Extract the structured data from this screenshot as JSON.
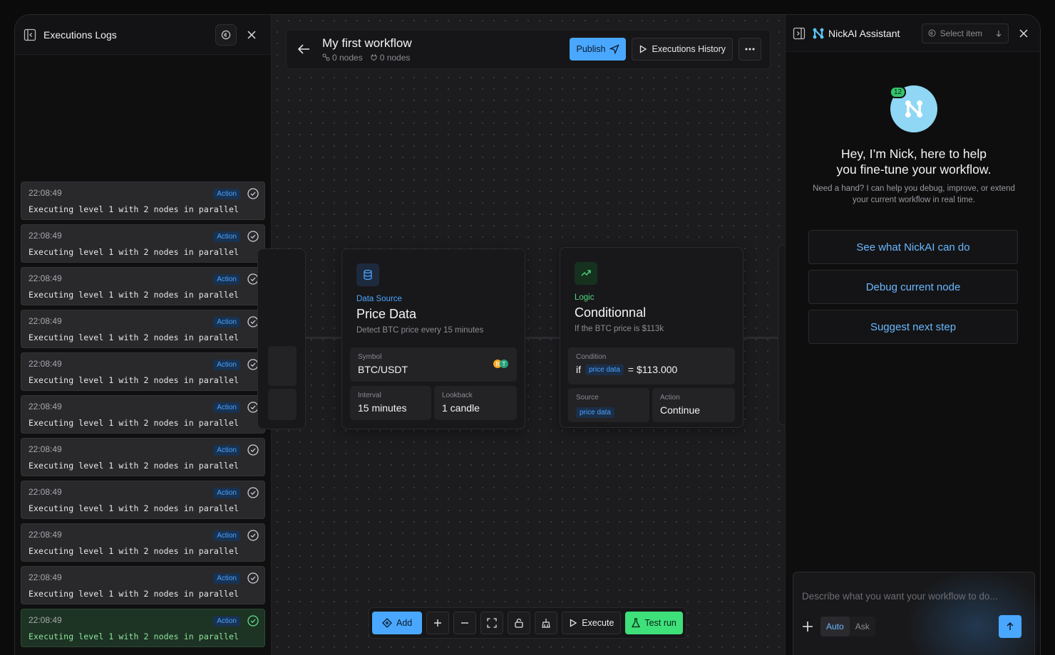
{
  "logs": {
    "title": "Executions Logs",
    "items": [
      {
        "time": "22:08:49",
        "badge": "Action",
        "message": "Executing level 1 with 2 nodes in parallel"
      },
      {
        "time": "22:08:49",
        "badge": "Action",
        "message": "Executing level 1 with 2 nodes in parallel"
      },
      {
        "time": "22:08:49",
        "badge": "Action",
        "message": "Executing level 1 with 2 nodes in parallel"
      },
      {
        "time": "22:08:49",
        "badge": "Action",
        "message": "Executing level 1 with 2 nodes in parallel"
      },
      {
        "time": "22:08:49",
        "badge": "Action",
        "message": "Executing level 1 with 2 nodes in parallel"
      },
      {
        "time": "22:08:49",
        "badge": "Action",
        "message": "Executing level 1 with 2 nodes in parallel"
      },
      {
        "time": "22:08:49",
        "badge": "Action",
        "message": "Executing level 1 with 2 nodes in parallel"
      },
      {
        "time": "22:08:49",
        "badge": "Action",
        "message": "Executing level 1 with 2 nodes in parallel"
      },
      {
        "time": "22:08:49",
        "badge": "Action",
        "message": "Executing level 1 with 2 nodes in parallel"
      },
      {
        "time": "22:08:49",
        "badge": "Action",
        "message": "Executing level 1 with 2 nodes in parallel"
      },
      {
        "time": "22:08:49",
        "badge": "Action",
        "message": "Executing level 1 with 2 nodes in parallel"
      }
    ]
  },
  "workflow": {
    "title": "My first workflow",
    "meta_nodes": "0 nodes",
    "meta_nodes_2": "0 nodes",
    "publish_label": "Publish",
    "history_label": "Executions History"
  },
  "nodes": {
    "price": {
      "kind": "Data Source",
      "title": "Price Data",
      "desc": "Detect BTC price every 15 minutes",
      "symbol_label": "Symbol",
      "symbol_value": "BTC/USDT",
      "interval_label": "Interval",
      "interval_value": "15 minutes",
      "lookback_label": "Lookback",
      "lookback_value": "1 candle"
    },
    "cond": {
      "kind": "Logic",
      "title": "Conditionnal",
      "desc": "If the BTC price is $113k",
      "condition_label": "Condition",
      "if_word": "if",
      "chip": "price data",
      "eq_value": "= $113.000",
      "source_label": "Source",
      "source_chip": "price data",
      "action_label": "Action",
      "action_value": "Continue"
    }
  },
  "toolbar": {
    "add_label": "Add",
    "execute_label": "Execute",
    "test_label": "Test run"
  },
  "assistant": {
    "title": "NickAI Assistant",
    "select_label": "Select item",
    "badge_count": "12",
    "greeting_1": "Hey, I’m Nick, here to help",
    "greeting_2": "you fine-tune your workflow.",
    "sub_1": "Need a hand? I can help you debug, improve, or extend",
    "sub_2": "your current workflow in real time.",
    "suggestions": [
      "See what NickAI can do",
      "Debug current node",
      "Suggest next step"
    ],
    "placeholder": "Describe what you want your workflow to do...",
    "mode_auto": "Auto",
    "mode_ask": "Ask"
  },
  "colors": {
    "accent": "#4aa7ff",
    "success": "#3ee07a",
    "badge_bg": "#183252"
  }
}
